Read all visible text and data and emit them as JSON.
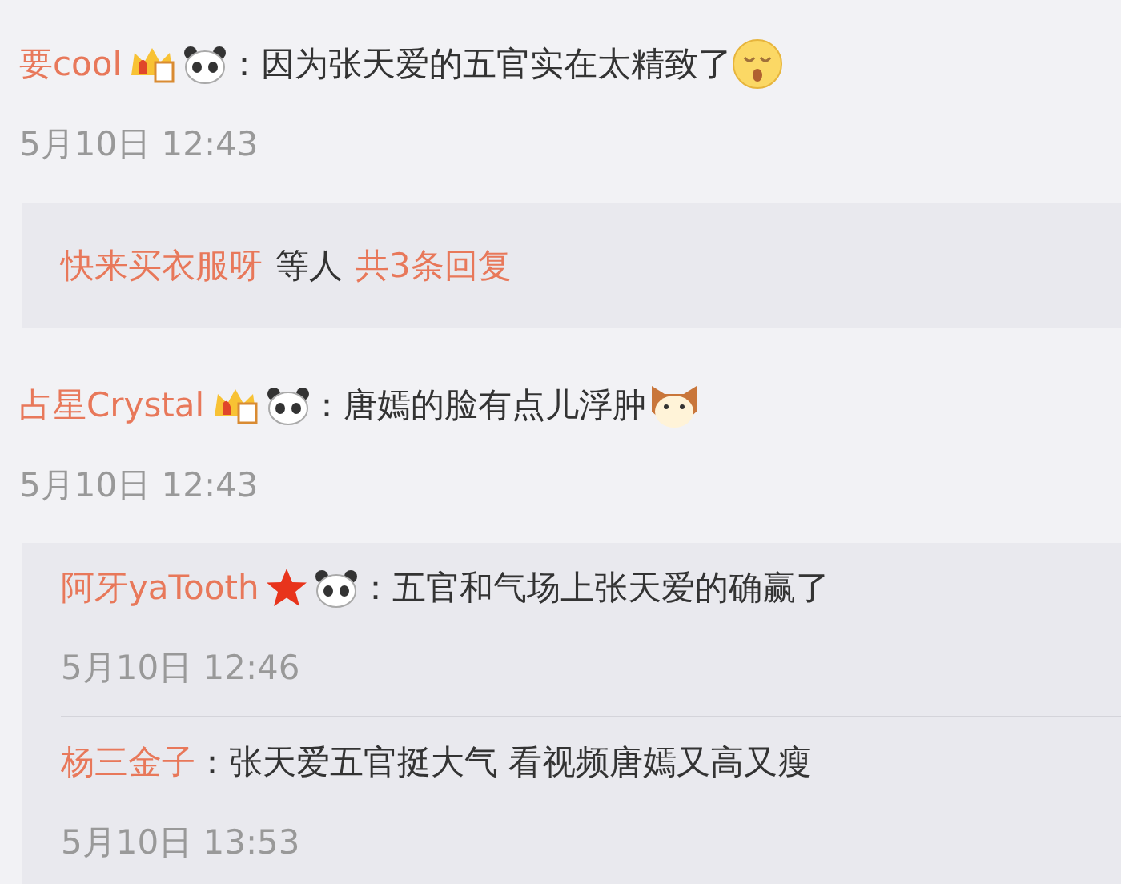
{
  "comments": [
    {
      "user": "要cool",
      "badges": [
        {
          "kind": "crown"
        },
        {
          "kind": "panda"
        }
      ],
      "text": "：因为张天爱的五官实在太精致了",
      "emoji": {
        "kind": "crying"
      },
      "time": "5月10日 12:43",
      "summary": {
        "users": "快来买衣服呀",
        "middle": "等人",
        "count": "共3条回复"
      }
    },
    {
      "user": "占星Crystal",
      "badges": [
        {
          "kind": "crown"
        },
        {
          "kind": "panda"
        }
      ],
      "text": "：唐嫣的脸有点儿浮肿",
      "emoji": {
        "kind": "cat"
      },
      "time": "5月10日 12:43",
      "replies": [
        {
          "user": "阿牙yaTooth",
          "badges": [
            {
              "kind": "star"
            },
            {
              "kind": "panda"
            }
          ],
          "text": "：五官和气场上张天爱的确赢了",
          "time": "5月10日 12:46"
        },
        {
          "user": "杨三金子",
          "text": "：张天爱五官挺大气 看视频唐嫣又高又瘦",
          "time": "5月10日 13:53"
        }
      ]
    }
  ]
}
